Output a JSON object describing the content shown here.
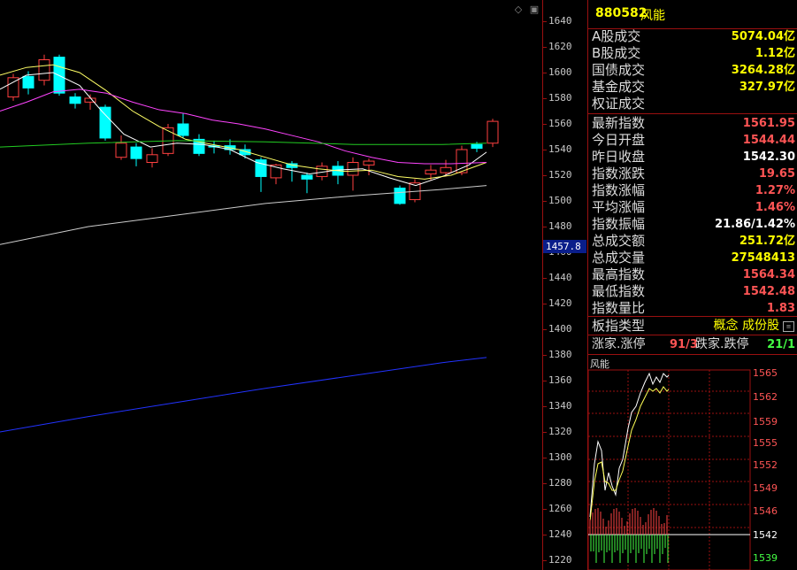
{
  "axis": {
    "ticks": [
      "1640",
      "1620",
      "1600",
      "1580",
      "1560",
      "1540",
      "1520",
      "1500",
      "1480",
      "1460",
      "1440",
      "1420",
      "1400",
      "1380",
      "1360",
      "1340",
      "1320",
      "1300",
      "1280",
      "1260",
      "1240",
      "1220"
    ],
    "cursor_value": "1457.8"
  },
  "controls": {
    "diamond": "◇",
    "square": "▣"
  },
  "panel": {
    "code": "880582",
    "name": "风能",
    "rows": [
      {
        "label": "A股成交",
        "value": "5074.04亿",
        "color": "#ffff00"
      },
      {
        "label": "B股成交",
        "value": "1.12亿",
        "color": "#ffff00"
      },
      {
        "label": "国债成交",
        "value": "3264.28亿",
        "color": "#ffff00"
      },
      {
        "label": "基金成交",
        "value": "327.97亿",
        "color": "#ffff00"
      },
      {
        "label": "权证成交",
        "value": "",
        "color": "#ffff00"
      },
      {
        "label": "最新指数",
        "value": "1561.95",
        "color": "#ff5555"
      },
      {
        "label": "今日开盘",
        "value": "1544.44",
        "color": "#ff5555"
      },
      {
        "label": "昨日收盘",
        "value": "1542.30",
        "color": "#ffffff"
      },
      {
        "label": "指数涨跌",
        "value": "19.65",
        "color": "#ff5555"
      },
      {
        "label": "指数涨幅",
        "value": "1.27%",
        "color": "#ff5555"
      },
      {
        "label": "平均涨幅",
        "value": "1.46%",
        "color": "#ff5555"
      },
      {
        "label": "指数振幅",
        "value": "21.86/1.42%",
        "color": "#ffffff"
      },
      {
        "label": "总成交额",
        "value": "251.72亿",
        "color": "#ffff00"
      },
      {
        "label": "总成交量",
        "value": "27548413",
        "color": "#ffff00"
      },
      {
        "label": "最高指数",
        "value": "1564.34",
        "color": "#ff5555"
      },
      {
        "label": "最低指数",
        "value": "1542.48",
        "color": "#ff5555"
      },
      {
        "label": "指数量比",
        "value": "1.83",
        "color": "#ff5555"
      }
    ],
    "type_label": "板指类型",
    "type_value": "概念 成份股",
    "updown": {
      "label1": "涨家.涨停",
      "value1": "91/3",
      "label2": "跌家.跌停",
      "value2": "21/1"
    }
  },
  "mini": {
    "title": "风能",
    "ticks": [
      "1565",
      "1562",
      "1559",
      "1555",
      "1552",
      "1549",
      "1546",
      "1542",
      "1539"
    ]
  },
  "colors": {
    "up": "#ff4040",
    "down": "#00ffff",
    "grid": "#9a1010",
    "ma5": "#ffffff",
    "ma10": "#ffff66",
    "ma20": "#ff44ff",
    "ma60": "#22cc22",
    "ma120": "#cccccc",
    "ma250": "#2233ff"
  }
}
